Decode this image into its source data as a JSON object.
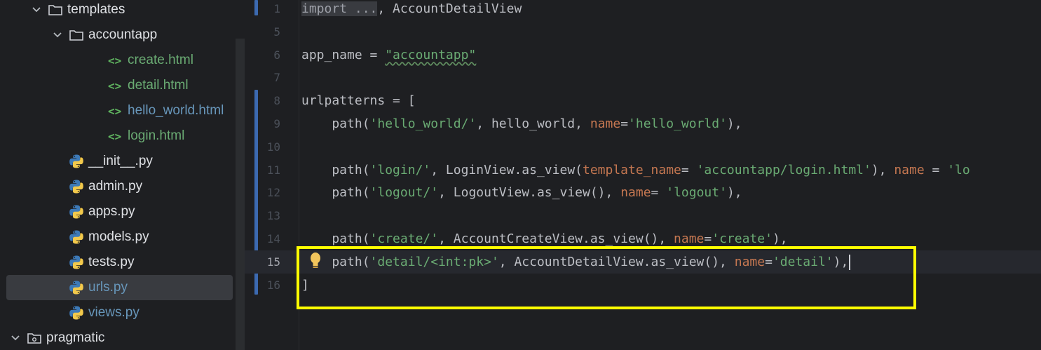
{
  "tree": {
    "items": [
      {
        "label": "templates",
        "kind": "folder",
        "chevron": "down",
        "level": 1,
        "color": "normal"
      },
      {
        "label": "accountapp",
        "kind": "folder",
        "chevron": "down",
        "level": 2,
        "color": "normal"
      },
      {
        "label": "create.html",
        "kind": "html",
        "level": 3,
        "color": "green"
      },
      {
        "label": "detail.html",
        "kind": "html",
        "level": 3,
        "color": "green"
      },
      {
        "label": "hello_world.html",
        "kind": "html",
        "level": 3,
        "color": "blue"
      },
      {
        "label": "login.html",
        "kind": "html",
        "level": 3,
        "color": "green"
      },
      {
        "label": "__init__.py",
        "kind": "python",
        "level": 2,
        "color": "normal"
      },
      {
        "label": "admin.py",
        "kind": "python",
        "level": 2,
        "color": "normal"
      },
      {
        "label": "apps.py",
        "kind": "python",
        "level": 2,
        "color": "normal"
      },
      {
        "label": "models.py",
        "kind": "python",
        "level": 2,
        "color": "normal"
      },
      {
        "label": "tests.py",
        "kind": "python",
        "level": 2,
        "color": "normal"
      },
      {
        "label": "urls.py",
        "kind": "python",
        "level": 2,
        "color": "blue",
        "selected": true
      },
      {
        "label": "views.py",
        "kind": "python",
        "level": 2,
        "color": "blue"
      },
      {
        "label": "pragmatic",
        "kind": "package",
        "chevron": "down",
        "level": 0,
        "color": "normal"
      }
    ]
  },
  "editor": {
    "current_line": "15",
    "lines": [
      {
        "n": "1",
        "tokens": [
          {
            "t": "import ...",
            "c": "fold"
          },
          {
            "t": ", AccountDetailView",
            "c": ""
          }
        ]
      },
      {
        "n": "5",
        "tokens": []
      },
      {
        "n": "6",
        "tokens": [
          {
            "t": "app_name = ",
            "c": ""
          },
          {
            "t": "\"accountapp\"",
            "c": "str-wavy"
          }
        ]
      },
      {
        "n": "7",
        "tokens": []
      },
      {
        "n": "8",
        "tokens": [
          {
            "t": "urlpatterns = [",
            "c": ""
          }
        ]
      },
      {
        "n": "9",
        "tokens": [
          {
            "t": "    path(",
            "c": ""
          },
          {
            "t": "'hello_world/'",
            "c": "str"
          },
          {
            "t": ", hello_world, ",
            "c": ""
          },
          {
            "t": "name",
            "c": "nm"
          },
          {
            "t": "=",
            "c": ""
          },
          {
            "t": "'hello_world'",
            "c": "str"
          },
          {
            "t": "),",
            "c": ""
          }
        ]
      },
      {
        "n": "10",
        "tokens": []
      },
      {
        "n": "11",
        "tokens": [
          {
            "t": "    path(",
            "c": ""
          },
          {
            "t": "'login/'",
            "c": "str"
          },
          {
            "t": ", LoginView.as_view(",
            "c": ""
          },
          {
            "t": "template_name",
            "c": "nm"
          },
          {
            "t": "= ",
            "c": ""
          },
          {
            "t": "'accountapp/login.html'",
            "c": "str"
          },
          {
            "t": "), ",
            "c": ""
          },
          {
            "t": "name",
            "c": "nm"
          },
          {
            "t": " = ",
            "c": ""
          },
          {
            "t": "'lo",
            "c": "str"
          }
        ]
      },
      {
        "n": "12",
        "tokens": [
          {
            "t": "    path(",
            "c": ""
          },
          {
            "t": "'logout/'",
            "c": "str"
          },
          {
            "t": ", LogoutView.as_view(), ",
            "c": ""
          },
          {
            "t": "name",
            "c": "nm"
          },
          {
            "t": "= ",
            "c": ""
          },
          {
            "t": "'logout'",
            "c": "str"
          },
          {
            "t": "),",
            "c": ""
          }
        ]
      },
      {
        "n": "13",
        "tokens": []
      },
      {
        "n": "14",
        "tokens": [
          {
            "t": "    path(",
            "c": ""
          },
          {
            "t": "'create/'",
            "c": "str"
          },
          {
            "t": ", AccountCreateView.as_view(), ",
            "c": ""
          },
          {
            "t": "name",
            "c": "nm"
          },
          {
            "t": "=",
            "c": ""
          },
          {
            "t": "'create'",
            "c": "str"
          },
          {
            "t": "),",
            "c": ""
          }
        ]
      },
      {
        "n": "15",
        "tokens": [
          {
            "t": "    path(",
            "c": ""
          },
          {
            "t": "'detail/<int:pk>'",
            "c": "str"
          },
          {
            "t": ", AccountDetailView.as_view(), ",
            "c": ""
          },
          {
            "t": "name",
            "c": "nm"
          },
          {
            "t": "=",
            "c": ""
          },
          {
            "t": "'detail'",
            "c": "str"
          },
          {
            "t": "),",
            "c": ""
          }
        ]
      },
      {
        "n": "16",
        "tokens": [
          {
            "t": "]",
            "c": ""
          }
        ]
      }
    ]
  },
  "colors": {
    "background": "#1e1f22",
    "selection": "#393b40",
    "highlight_box": "#ffff00",
    "string": "#6aab73",
    "named_arg": "#c57751",
    "change_bar": "#3c6ab1"
  }
}
